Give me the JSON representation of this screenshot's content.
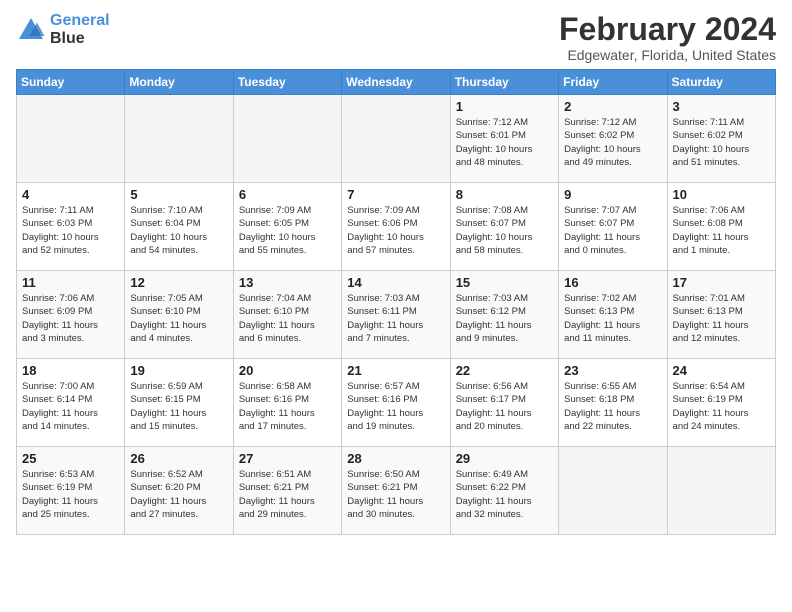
{
  "logo": {
    "line1": "General",
    "line2": "Blue"
  },
  "title": "February 2024",
  "subtitle": "Edgewater, Florida, United States",
  "days_of_week": [
    "Sunday",
    "Monday",
    "Tuesday",
    "Wednesday",
    "Thursday",
    "Friday",
    "Saturday"
  ],
  "weeks": [
    [
      {
        "day": "",
        "info": ""
      },
      {
        "day": "",
        "info": ""
      },
      {
        "day": "",
        "info": ""
      },
      {
        "day": "",
        "info": ""
      },
      {
        "day": "1",
        "info": "Sunrise: 7:12 AM\nSunset: 6:01 PM\nDaylight: 10 hours\nand 48 minutes."
      },
      {
        "day": "2",
        "info": "Sunrise: 7:12 AM\nSunset: 6:02 PM\nDaylight: 10 hours\nand 49 minutes."
      },
      {
        "day": "3",
        "info": "Sunrise: 7:11 AM\nSunset: 6:02 PM\nDaylight: 10 hours\nand 51 minutes."
      }
    ],
    [
      {
        "day": "4",
        "info": "Sunrise: 7:11 AM\nSunset: 6:03 PM\nDaylight: 10 hours\nand 52 minutes."
      },
      {
        "day": "5",
        "info": "Sunrise: 7:10 AM\nSunset: 6:04 PM\nDaylight: 10 hours\nand 54 minutes."
      },
      {
        "day": "6",
        "info": "Sunrise: 7:09 AM\nSunset: 6:05 PM\nDaylight: 10 hours\nand 55 minutes."
      },
      {
        "day": "7",
        "info": "Sunrise: 7:09 AM\nSunset: 6:06 PM\nDaylight: 10 hours\nand 57 minutes."
      },
      {
        "day": "8",
        "info": "Sunrise: 7:08 AM\nSunset: 6:07 PM\nDaylight: 10 hours\nand 58 minutes."
      },
      {
        "day": "9",
        "info": "Sunrise: 7:07 AM\nSunset: 6:07 PM\nDaylight: 11 hours\nand 0 minutes."
      },
      {
        "day": "10",
        "info": "Sunrise: 7:06 AM\nSunset: 6:08 PM\nDaylight: 11 hours\nand 1 minute."
      }
    ],
    [
      {
        "day": "11",
        "info": "Sunrise: 7:06 AM\nSunset: 6:09 PM\nDaylight: 11 hours\nand 3 minutes."
      },
      {
        "day": "12",
        "info": "Sunrise: 7:05 AM\nSunset: 6:10 PM\nDaylight: 11 hours\nand 4 minutes."
      },
      {
        "day": "13",
        "info": "Sunrise: 7:04 AM\nSunset: 6:10 PM\nDaylight: 11 hours\nand 6 minutes."
      },
      {
        "day": "14",
        "info": "Sunrise: 7:03 AM\nSunset: 6:11 PM\nDaylight: 11 hours\nand 7 minutes."
      },
      {
        "day": "15",
        "info": "Sunrise: 7:03 AM\nSunset: 6:12 PM\nDaylight: 11 hours\nand 9 minutes."
      },
      {
        "day": "16",
        "info": "Sunrise: 7:02 AM\nSunset: 6:13 PM\nDaylight: 11 hours\nand 11 minutes."
      },
      {
        "day": "17",
        "info": "Sunrise: 7:01 AM\nSunset: 6:13 PM\nDaylight: 11 hours\nand 12 minutes."
      }
    ],
    [
      {
        "day": "18",
        "info": "Sunrise: 7:00 AM\nSunset: 6:14 PM\nDaylight: 11 hours\nand 14 minutes."
      },
      {
        "day": "19",
        "info": "Sunrise: 6:59 AM\nSunset: 6:15 PM\nDaylight: 11 hours\nand 15 minutes."
      },
      {
        "day": "20",
        "info": "Sunrise: 6:58 AM\nSunset: 6:16 PM\nDaylight: 11 hours\nand 17 minutes."
      },
      {
        "day": "21",
        "info": "Sunrise: 6:57 AM\nSunset: 6:16 PM\nDaylight: 11 hours\nand 19 minutes."
      },
      {
        "day": "22",
        "info": "Sunrise: 6:56 AM\nSunset: 6:17 PM\nDaylight: 11 hours\nand 20 minutes."
      },
      {
        "day": "23",
        "info": "Sunrise: 6:55 AM\nSunset: 6:18 PM\nDaylight: 11 hours\nand 22 minutes."
      },
      {
        "day": "24",
        "info": "Sunrise: 6:54 AM\nSunset: 6:19 PM\nDaylight: 11 hours\nand 24 minutes."
      }
    ],
    [
      {
        "day": "25",
        "info": "Sunrise: 6:53 AM\nSunset: 6:19 PM\nDaylight: 11 hours\nand 25 minutes."
      },
      {
        "day": "26",
        "info": "Sunrise: 6:52 AM\nSunset: 6:20 PM\nDaylight: 11 hours\nand 27 minutes."
      },
      {
        "day": "27",
        "info": "Sunrise: 6:51 AM\nSunset: 6:21 PM\nDaylight: 11 hours\nand 29 minutes."
      },
      {
        "day": "28",
        "info": "Sunrise: 6:50 AM\nSunset: 6:21 PM\nDaylight: 11 hours\nand 30 minutes."
      },
      {
        "day": "29",
        "info": "Sunrise: 6:49 AM\nSunset: 6:22 PM\nDaylight: 11 hours\nand 32 minutes."
      },
      {
        "day": "",
        "info": ""
      },
      {
        "day": "",
        "info": ""
      }
    ]
  ]
}
